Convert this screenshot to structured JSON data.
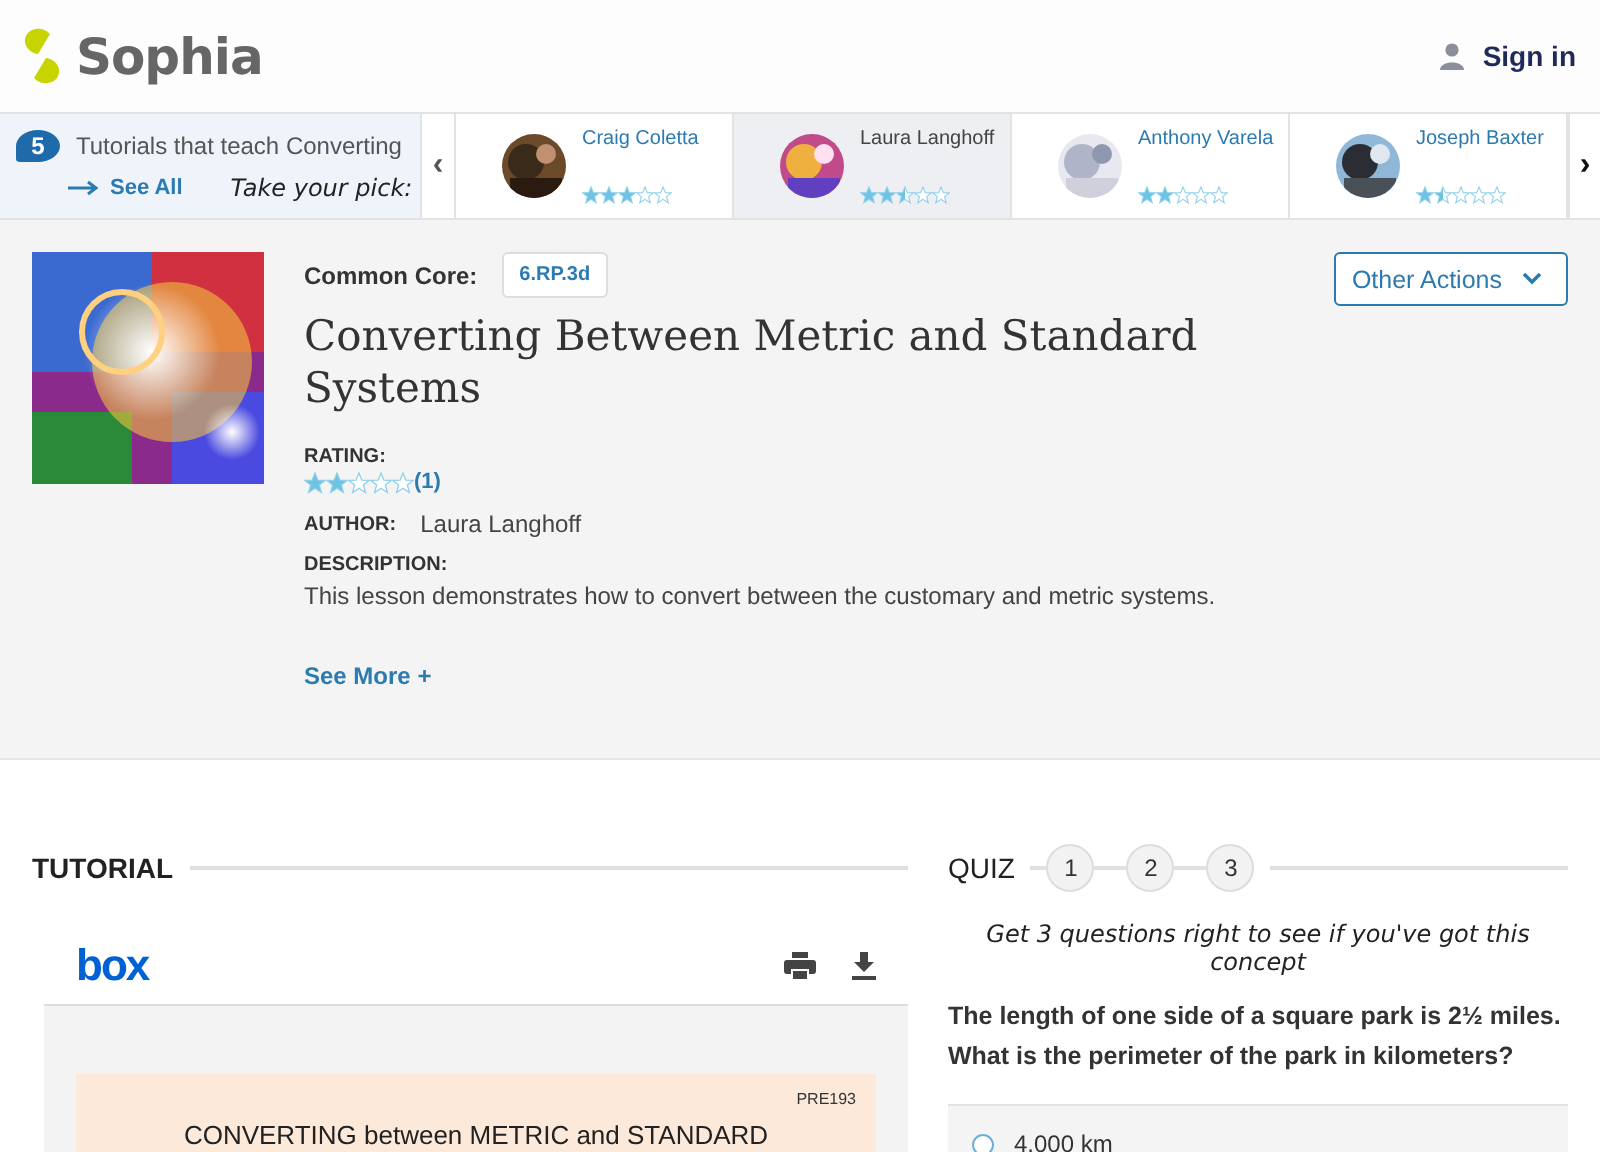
{
  "header": {
    "logo": "Sophia",
    "sign_in": "Sign in"
  },
  "carousel": {
    "count": "5",
    "title": "Tutorials that teach Converting",
    "see_all": "See All",
    "pick": "Take your pick:",
    "prev": "‹",
    "next": "›",
    "tutors": [
      {
        "name": "Craig Coletta",
        "stars": 3,
        "selected": false
      },
      {
        "name": "Laura Langhoff",
        "stars": 2.5,
        "selected": true
      },
      {
        "name": "Anthony Varela",
        "stars": 2,
        "selected": false
      },
      {
        "name": "Joseph Baxter",
        "stars": 1.5,
        "selected": false
      }
    ]
  },
  "lesson": {
    "core_label": "Common Core:",
    "core_tag": "6.RP.3d",
    "title": "Converting Between Metric and Standard Systems",
    "actions": "Other Actions",
    "rating_label": "RATING:",
    "stars": 2,
    "rating_count": "(1)",
    "author_label": "AUTHOR:",
    "author": "Laura Langhoff",
    "description_label": "DESCRIPTION:",
    "description": "This lesson demonstrates how to convert between the customary and metric systems.",
    "see_more": "See More +"
  },
  "tutorial": {
    "heading": "TUTORIAL",
    "viewer_logo": "box",
    "doc_code": "PRE193",
    "doc_title": "CONVERTING between METRIC and STANDARD"
  },
  "quiz": {
    "heading": "QUIZ",
    "steps": [
      "1",
      "2",
      "3"
    ],
    "prompt": "Get 3 questions right to see if you've got this concept",
    "question": "The length of one side of a square park is 2½ miles. What is the perimeter of the park in kilometers?",
    "options": [
      {
        "label": "4.000 km",
        "selected": false
      }
    ]
  }
}
